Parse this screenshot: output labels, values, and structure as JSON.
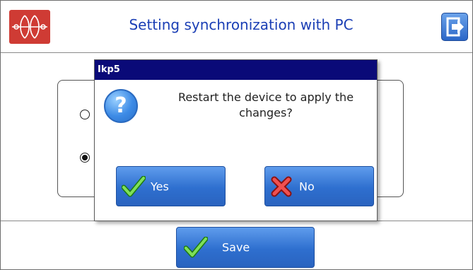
{
  "header": {
    "title": "Setting synchronization with PC",
    "logo_icon": "synchronization-logo-icon",
    "exit_icon": "exit-icon"
  },
  "options": {
    "radio1_checked": false,
    "radio2_checked": true
  },
  "footer": {
    "save_label": "Save",
    "save_icon": "check-icon"
  },
  "dialog": {
    "title": "Ikp5",
    "message_line1": "Restart the device to apply the",
    "message_line2": "changes?",
    "icon": "question-icon",
    "yes_label": "Yes",
    "no_label": "No",
    "yes_icon": "check-icon",
    "no_icon": "x-icon"
  },
  "colors": {
    "title_text": "#1b3fb5",
    "dialog_titlebar": "#0a0a78",
    "button_blue": "#2e6fcf",
    "logo_red": "#cf3b34"
  }
}
